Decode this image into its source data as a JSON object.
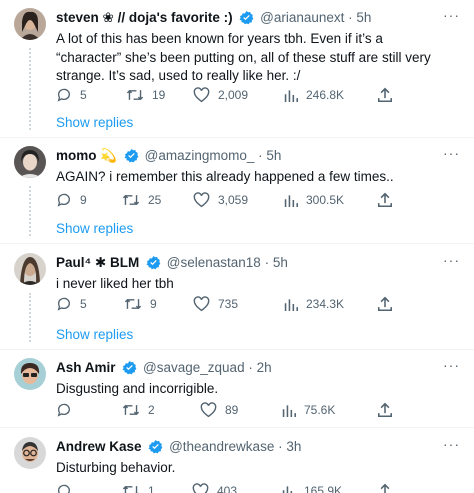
{
  "tweets": [
    {
      "name": "steven ❀ // doja's favorite :)",
      "handle": "@arianaunext",
      "sep": "·",
      "time": "5h",
      "text": "A lot of this has been known for years tbh. Even if it’s a “character” she’s been putting on, all of these stuff are still very strange. It’s sad, used to really like her. :/",
      "replies": "5",
      "retweets": "19",
      "likes": "2,009",
      "views": "246.8K",
      "show_replies": "Show replies"
    },
    {
      "name": "momo",
      "emoji": "💫",
      "handle": "@amazingmomo_",
      "sep": "·",
      "time": "5h",
      "text": "AGAIN? i remember this already happened a few times..",
      "replies": "9",
      "retweets": "25",
      "likes": "3,059",
      "views": "300.5K",
      "show_replies": "Show replies"
    },
    {
      "name": "Paul⁴ ✱ BLM",
      "handle": "@selenastan18",
      "sep": "·",
      "time": "5h",
      "text": "i never liked her tbh",
      "replies": "5",
      "retweets": "9",
      "likes": "735",
      "views": "234.3K",
      "show_replies": "Show replies"
    },
    {
      "name": "Ash Amir",
      "handle": "@savage_zquad",
      "sep": "·",
      "time": "2h",
      "text": "Disgusting and incorrigible.",
      "replies": "",
      "retweets": "2",
      "likes": "89",
      "views": "75.6K"
    },
    {
      "name": "Andrew Kase",
      "handle": "@theandrewkase",
      "sep": "·",
      "time": "3h",
      "text": "Disturbing behavior.",
      "replies": "",
      "retweets": "1",
      "likes": "403",
      "views": "165.9K"
    }
  ],
  "more_label": "···",
  "icons": {
    "reply": "reply-icon",
    "retweet": "retweet-icon",
    "like": "like-icon",
    "views": "views-icon",
    "share": "share-icon",
    "verified": "verified-badge-icon",
    "more": "more-options-icon"
  },
  "colors": {
    "verified": "#1d9bf0",
    "link": "#1d9bf0",
    "secondary": "#536471",
    "primary": "#0f1419"
  }
}
